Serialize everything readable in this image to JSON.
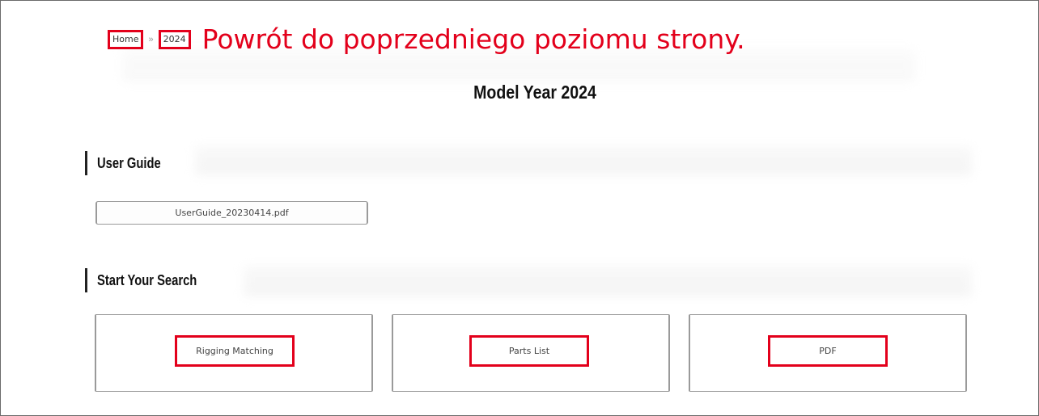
{
  "breadcrumb": {
    "home_label": "Home",
    "year_label": "2024",
    "separator": "»"
  },
  "annotation": "Powrót do poprzedniego poziomu strony.",
  "page_title": "Model Year 2024",
  "sections": {
    "user_guide": {
      "heading": "User Guide",
      "file_label": "UserGuide_20230414.pdf"
    },
    "search": {
      "heading": "Start Your Search",
      "cards": [
        {
          "label": "Rigging Matching"
        },
        {
          "label": "Parts List"
        },
        {
          "label": "PDF"
        }
      ]
    }
  },
  "colors": {
    "highlight": "#e3001b",
    "border": "#9a9a9a"
  }
}
